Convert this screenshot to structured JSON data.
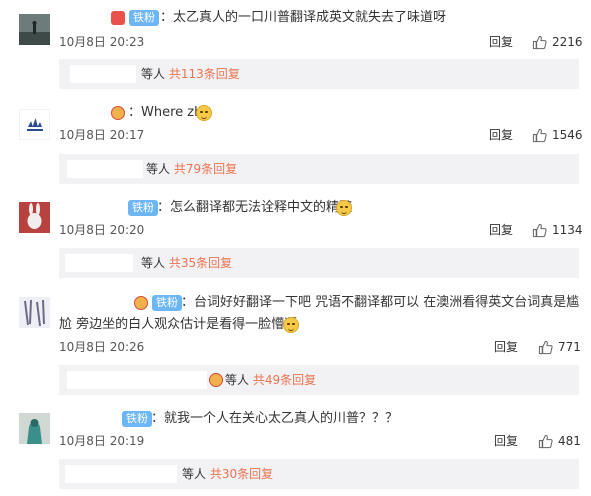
{
  "ui": {
    "like_icon": "thumbs-up-icon",
    "accent_color": "#eb7350",
    "fan_badge_color": "#6cb6f5"
  },
  "comments": [
    {
      "badge": "铁粉",
      "text": "：太乙真人的一口川普翻译成英文就失去了味道呀",
      "time": "10月8日 20:23",
      "reply_label": "回复",
      "likes": "2216",
      "replies": {
        "prefix": "等人",
        "count_text": "共113条回复"
      }
    },
    {
      "badge": "",
      "text": "：Where zha",
      "time": "10月8日 20:17",
      "reply_label": "回复",
      "likes": "1546",
      "replies": {
        "prefix": "等人",
        "count_text": "共79条回复"
      }
    },
    {
      "badge": "铁粉",
      "text": "：怎么翻译都无法诠释中文的精髓",
      "time": "10月8日 20:20",
      "reply_label": "回复",
      "likes": "1134",
      "replies": {
        "prefix": "等人",
        "count_text": "共35条回复"
      }
    },
    {
      "badge": "铁粉",
      "text": "：台词好好翻译一下吧  咒语不翻译都可以  在澳洲看得英文台词真是尴",
      "text2": "尬  旁边坐的白人观众估计是看得一脸懵逼",
      "time": "10月8日 20:26",
      "reply_label": "回复",
      "likes": "771",
      "replies": {
        "prefix": "等人",
        "count_text": "共49条回复"
      }
    },
    {
      "badge": "铁粉",
      "text": "：就我一个人在关心太乙真人的川普？？？",
      "time": "10月8日 20:19",
      "reply_label": "回复",
      "likes": "481",
      "replies": {
        "prefix": "等人",
        "count_text": "共30条回复"
      }
    }
  ]
}
